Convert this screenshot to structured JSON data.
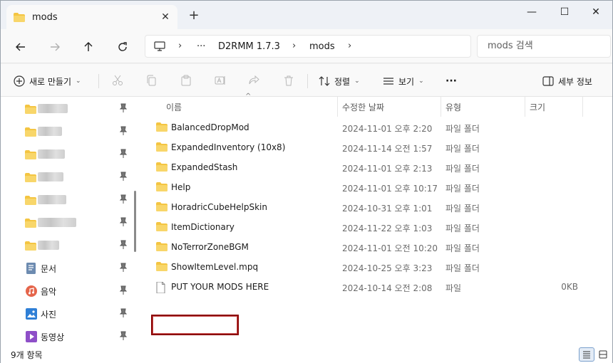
{
  "tab": {
    "title": "mods",
    "close_glyph": "✕",
    "new_tab_glyph": "+"
  },
  "window_controls": {
    "minimize": "—",
    "maximize": "☐",
    "close": "✕"
  },
  "address": {
    "crumbs": [
      "D2RMM 1.7.3",
      "mods"
    ],
    "ellipsis": "···",
    "separator": "›"
  },
  "search": {
    "placeholder": "mods 검색"
  },
  "toolbar": {
    "new_label": "새로 만들기",
    "sort_label": "정렬",
    "view_label": "보기",
    "more_label": "···",
    "details_label": "세부 정보"
  },
  "sidebar": {
    "items": [
      {
        "label": "문서",
        "icon": "documents-icon"
      },
      {
        "label": "음악",
        "icon": "music-icon"
      },
      {
        "label": "사진",
        "icon": "pictures-icon"
      },
      {
        "label": "동영상",
        "icon": "videos-icon"
      }
    ]
  },
  "columns": {
    "name": "이름",
    "date": "수정한 날짜",
    "type": "유형",
    "size": "크기"
  },
  "files": [
    {
      "name": "BalancedDropMod",
      "date": "2024-11-01 오후 2:20",
      "type": "파일 폴더",
      "size": "",
      "kind": "folder"
    },
    {
      "name": "ExpandedInventory (10x8)",
      "date": "2024-11-14 오전 1:57",
      "type": "파일 폴더",
      "size": "",
      "kind": "folder"
    },
    {
      "name": "ExpandedStash",
      "date": "2024-11-01 오후 2:13",
      "type": "파일 폴더",
      "size": "",
      "kind": "folder"
    },
    {
      "name": "Help",
      "date": "2024-11-01 오후 10:17",
      "type": "파일 폴더",
      "size": "",
      "kind": "folder"
    },
    {
      "name": "HoradricCubeHelpSkin",
      "date": "2024-10-31 오후 1:01",
      "type": "파일 폴더",
      "size": "",
      "kind": "folder"
    },
    {
      "name": "ItemDictionary",
      "date": "2024-11-22 오후 1:03",
      "type": "파일 폴더",
      "size": "",
      "kind": "folder"
    },
    {
      "name": "NoTerrorZoneBGM",
      "date": "2024-11-01 오전 10:20",
      "type": "파일 폴더",
      "size": "",
      "kind": "folder"
    },
    {
      "name": "ShowItemLevel.mpq",
      "date": "2024-10-25 오후 3:23",
      "type": "파일 폴더",
      "size": "",
      "kind": "folder"
    },
    {
      "name": "PUT YOUR MODS HERE",
      "date": "2024-10-14 오전 2:08",
      "type": "파일",
      "size": "0KB",
      "kind": "file"
    }
  ],
  "status": {
    "count": "9개 항목"
  },
  "colors": {
    "folder": "#f4c542",
    "highlight": "#8b0000"
  }
}
